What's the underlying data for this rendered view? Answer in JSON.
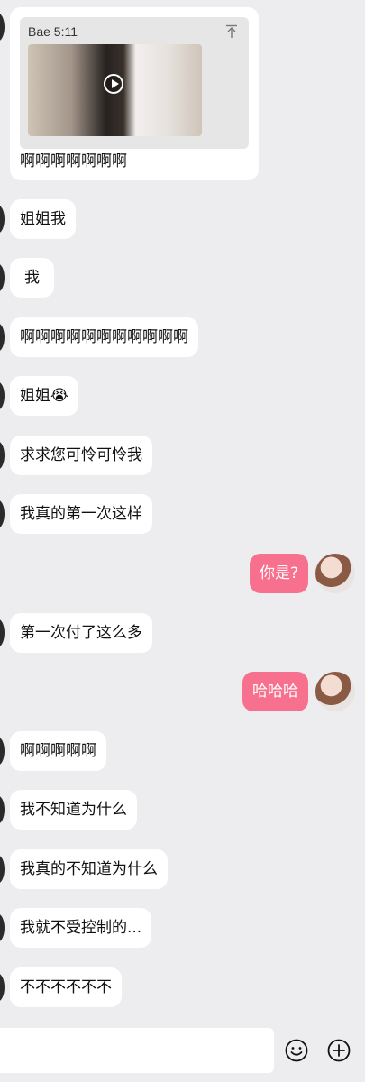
{
  "video_card": {
    "title": "Bae 5:11",
    "caption": "啊啊啊啊啊啊啊",
    "icons": [
      "pin-top-icon",
      "play-icon"
    ]
  },
  "messages": [
    {
      "side": "in",
      "text": "姐姐我"
    },
    {
      "side": "in",
      "text": "我"
    },
    {
      "side": "in",
      "text": "啊啊啊啊啊啊啊啊啊啊啊"
    },
    {
      "side": "in",
      "text": "姐姐😭"
    },
    {
      "side": "in",
      "text": "求求您可怜可怜我"
    },
    {
      "side": "in",
      "text": "我真的第一次这样"
    },
    {
      "side": "out",
      "text": "你是?"
    },
    {
      "side": "in",
      "text": "第一次付了这么多"
    },
    {
      "side": "out",
      "text": "哈哈哈"
    },
    {
      "side": "in",
      "text": "啊啊啊啊啊"
    },
    {
      "side": "in",
      "text": "我不知道为什么"
    },
    {
      "side": "in",
      "text": "我真的不知道为什么"
    },
    {
      "side": "in",
      "text": "我就不受控制的..."
    },
    {
      "side": "in",
      "text": "不不不不不不"
    }
  ],
  "input_bar": {
    "value": "",
    "placeholder": "",
    "icons": [
      "emoji-icon",
      "plus-icon"
    ]
  },
  "colors": {
    "background": "#ededf0",
    "incoming_bubble": "#ffffff",
    "outgoing_bubble": "#f7718f",
    "outgoing_text": "#ffffff"
  }
}
